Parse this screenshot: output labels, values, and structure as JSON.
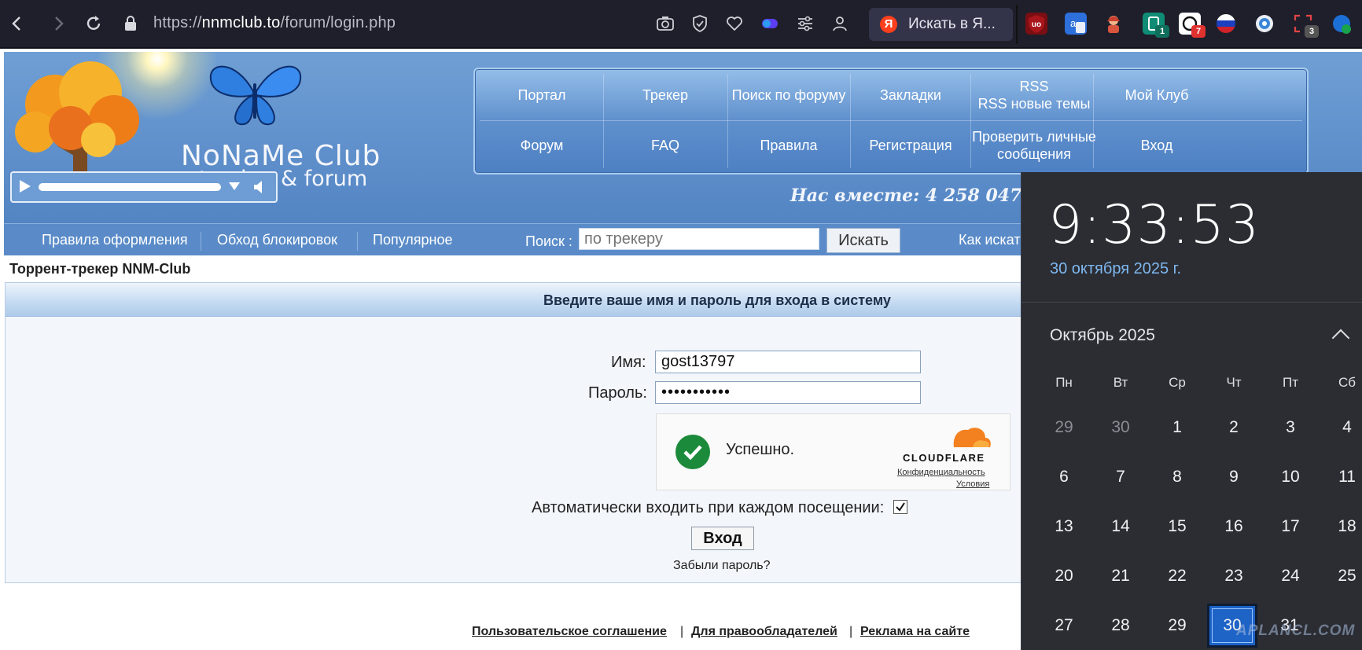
{
  "browser": {
    "url_prefix": "https://",
    "url_domain": "nnmclub.to",
    "url_path": "/forum/login.php",
    "yandex_search_label": "Искать в Я...",
    "extension_badges": [
      "1",
      "7",
      "3"
    ]
  },
  "header": {
    "logo_title": "NoNaMe Club",
    "logo_subtitle": "tracker & forum",
    "members_together": "Нас вместе: 4 258 047",
    "menu_row1": [
      "Портал",
      "Трекер",
      "Поиск по форуму",
      "Закладки",
      "RSS\nRSS новые темы",
      "Мой Клуб"
    ],
    "menu_row2": [
      "Форум",
      "FAQ",
      "Правила",
      "Регистрация",
      "Проверить личные сообщения",
      "Вход"
    ]
  },
  "subnav": {
    "links": [
      "Правила оформления",
      "Обход блокировок",
      "Популярное"
    ],
    "search_label": "Поиск :",
    "search_placeholder": "по трекеру",
    "search_button": "Искать",
    "how_to": "Как искат"
  },
  "page": {
    "title": "Торрент-трекер NNM-Club",
    "panel_header": "Введите ваше имя и пароль для входа в систему",
    "username_label": "Имя:",
    "username_value": "gost13797",
    "password_label": "Пароль:",
    "password_value": "•••••••••••",
    "captcha_status": "Успешно.",
    "captcha_brand": "CLOUDFLARE",
    "captcha_privacy": "Конфиденциальность",
    "captcha_terms": "Условия",
    "autologin_label": "Автоматически входить при каждом посещении:",
    "autologin_checked": true,
    "submit_label": "Вход",
    "forgot_label": "Забыли пароль?"
  },
  "footer": {
    "links": [
      "Пользовательское соглашение",
      "Для правообладателей",
      "Реклама на сайте"
    ],
    "separator": "|"
  },
  "clock": {
    "time": "9:33:53",
    "date": "30 октября 2025 г.",
    "month": "Октябрь 2025",
    "weekdays": [
      "Пн",
      "Вт",
      "Ср",
      "Чт",
      "Пт",
      "Сб"
    ],
    "weeks": [
      [
        "29",
        "30",
        "1",
        "2",
        "3",
        "4"
      ],
      [
        "6",
        "7",
        "8",
        "9",
        "10",
        "11"
      ],
      [
        "13",
        "14",
        "15",
        "16",
        "17",
        "18"
      ],
      [
        "20",
        "21",
        "22",
        "23",
        "24",
        "25"
      ],
      [
        "27",
        "28",
        "29",
        "30",
        "31",
        ""
      ]
    ],
    "today": "30",
    "watermark": "APLANCL.COM"
  },
  "colors": {
    "accent": "#1e63c6",
    "header_blue": "#5a8bc8",
    "date_blue": "#7fb8f0"
  }
}
